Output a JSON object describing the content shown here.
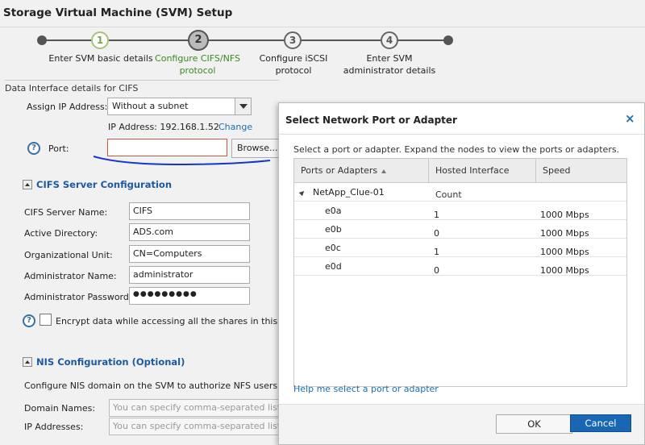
{
  "window": {
    "title": "Storage Virtual Machine (SVM) Setup"
  },
  "wizard": {
    "steps": [
      {
        "number": "1",
        "label_line1": "Enter SVM basic details",
        "label_line2": ""
      },
      {
        "number": "2",
        "label_line1": "Configure CIFS/NFS",
        "label_line2": "protocol"
      },
      {
        "number": "3",
        "label_line1": "Configure iSCSI",
        "label_line2": "protocol"
      },
      {
        "number": "4",
        "label_line1": "Enter SVM",
        "label_line2": "administrator details"
      }
    ]
  },
  "data_interface": {
    "heading": "Data Interface details for CIFS",
    "assign_ip_label": "Assign IP Address:",
    "assign_ip_value": "Without a subnet",
    "ip_address_text": "IP Address: 192.168.1.52",
    "change_link": "Change",
    "port_label": "Port:",
    "port_value": "",
    "browse_button": "Browse..."
  },
  "cifs": {
    "title": "CIFS Server Configuration",
    "fields": [
      {
        "label": "CIFS Server Name:",
        "value": "CIFS"
      },
      {
        "label": "Active Directory:",
        "value": "ADS.com"
      },
      {
        "label": "Organizational Unit:",
        "value": "CN=Computers"
      },
      {
        "label": "Administrator Name:",
        "value": "administrator"
      },
      {
        "label": "Administrator Password:",
        "value": "●●●●●●●●●"
      }
    ],
    "encrypt_label": "Encrypt data while accessing all the shares in this SVM"
  },
  "nis": {
    "title": "NIS Configuration (Optional)",
    "description": "Configure NIS domain on the SVM to authorize NFS users.",
    "domain_label": "Domain Names:",
    "domain_placeholder": "You can specify comma-separated list of v",
    "ip_label": "IP Addresses:",
    "ip_placeholder": "You can specify comma-separated list of v"
  },
  "dialog": {
    "title": "Select Network Port or Adapter",
    "close_glyph": "×",
    "description": "Select a port or adapter. Expand the nodes to view the ports or adapters.",
    "columns": [
      "Ports or Adapters",
      "Hosted Interface Count",
      "Speed"
    ],
    "node": "NetApp_Clue-01",
    "rows": [
      {
        "port": "e0a",
        "count": "1",
        "speed": "1000 Mbps"
      },
      {
        "port": "e0b",
        "count": "0",
        "speed": "1000 Mbps"
      },
      {
        "port": "e0c",
        "count": "1",
        "speed": "1000 Mbps"
      },
      {
        "port": "e0d",
        "count": "0",
        "speed": "1000 Mbps"
      }
    ],
    "help_link": "Help me select a port or adapter",
    "ok_button": "OK",
    "cancel_button": "Cancel"
  },
  "colors": {
    "accent_blue": "#1866b4",
    "link_blue": "#1a6fb5",
    "active_step_green": "#3a8a1f",
    "error_border": "#d4553d"
  }
}
